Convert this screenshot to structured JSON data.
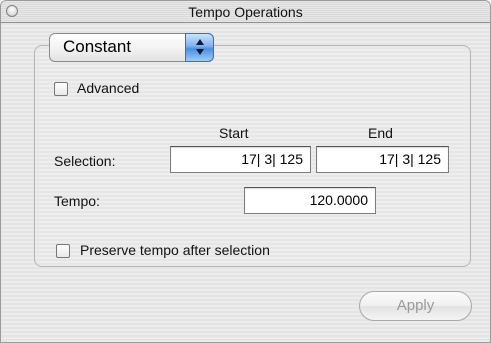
{
  "window": {
    "title": "Tempo Operations"
  },
  "mode_popup": {
    "selected": "Constant",
    "icon": "updown-arrows-icon"
  },
  "advanced": {
    "label": "Advanced",
    "checked": false
  },
  "columns": {
    "start": "Start",
    "end": "End"
  },
  "selection": {
    "label": "Selection:",
    "start_value": "17| 3| 125",
    "end_value": "17| 3| 125"
  },
  "tempo": {
    "label": "Tempo:",
    "value": "120.0000"
  },
  "preserve": {
    "label": "Preserve tempo after selection",
    "checked": false
  },
  "apply_button": {
    "label": "Apply",
    "enabled": false
  },
  "colors": {
    "popup_accent": "#4e8ee0",
    "disabled_text": "#9a9a9a"
  }
}
